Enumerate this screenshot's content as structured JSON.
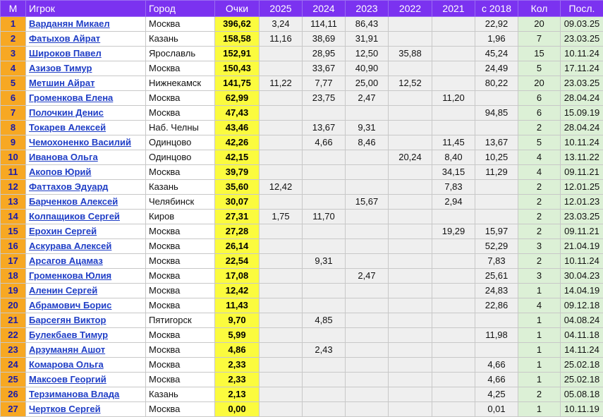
{
  "headers": [
    "М",
    "Игрок",
    "Город",
    "Очки",
    "2025",
    "2024",
    "2023",
    "2022",
    "2021",
    "с 2018",
    "Кол",
    "Посл."
  ],
  "rows": [
    {
      "rank": "1",
      "name": "Варданян Микаел",
      "city": "Москва",
      "points": "396,62",
      "y2025": "3,24",
      "y2024": "114,11",
      "y2023": "86,43",
      "y2022": "",
      "y2021": "",
      "since2018": "22,92",
      "count": "20",
      "last": "09.03.25"
    },
    {
      "rank": "2",
      "name": "Фатыхов Айрат",
      "city": "Казань",
      "points": "158,58",
      "y2025": "11,16",
      "y2024": "38,69",
      "y2023": "31,91",
      "y2022": "",
      "y2021": "",
      "since2018": "1,96",
      "count": "7",
      "last": "23.03.25"
    },
    {
      "rank": "3",
      "name": "Широков Павел",
      "city": "Ярославль",
      "points": "152,91",
      "y2025": "",
      "y2024": "28,95",
      "y2023": "12,50",
      "y2022": "35,88",
      "y2021": "",
      "since2018": "45,24",
      "count": "15",
      "last": "10.11.24"
    },
    {
      "rank": "4",
      "name": "Азизов Тимур",
      "city": "Москва",
      "points": "150,43",
      "y2025": "",
      "y2024": "33,67",
      "y2023": "40,90",
      "y2022": "",
      "y2021": "",
      "since2018": "24,49",
      "count": "5",
      "last": "17.11.24"
    },
    {
      "rank": "5",
      "name": "Метшин Айрат",
      "city": "Нижнекамск",
      "points": "141,75",
      "y2025": "11,22",
      "y2024": "7,77",
      "y2023": "25,00",
      "y2022": "12,52",
      "y2021": "",
      "since2018": "80,22",
      "count": "20",
      "last": "23.03.25"
    },
    {
      "rank": "6",
      "name": "Громенкова Елена",
      "city": "Москва",
      "points": "62,99",
      "y2025": "",
      "y2024": "23,75",
      "y2023": "2,47",
      "y2022": "",
      "y2021": "11,20",
      "since2018": "",
      "count": "6",
      "last": "28.04.24"
    },
    {
      "rank": "7",
      "name": "Полочкин Денис",
      "city": "Москва",
      "points": "47,43",
      "y2025": "",
      "y2024": "",
      "y2023": "",
      "y2022": "",
      "y2021": "",
      "since2018": "94,85",
      "count": "6",
      "last": "15.09.19"
    },
    {
      "rank": "8",
      "name": "Токарев Алексей",
      "city": "Наб. Челны",
      "points": "43,46",
      "y2025": "",
      "y2024": "13,67",
      "y2023": "9,31",
      "y2022": "",
      "y2021": "",
      "since2018": "",
      "count": "2",
      "last": "28.04.24"
    },
    {
      "rank": "9",
      "name": "Чемохоненко Василий",
      "city": "Одинцово",
      "points": "42,26",
      "y2025": "",
      "y2024": "4,66",
      "y2023": "8,46",
      "y2022": "",
      "y2021": "11,45",
      "since2018": "13,67",
      "count": "5",
      "last": "10.11.24"
    },
    {
      "rank": "10",
      "name": "Иванова Ольга",
      "city": "Одинцово",
      "points": "42,15",
      "y2025": "",
      "y2024": "",
      "y2023": "",
      "y2022": "20,24",
      "y2021": "8,40",
      "since2018": "10,25",
      "count": "4",
      "last": "13.11.22"
    },
    {
      "rank": "11",
      "name": "Акопов Юрий",
      "city": "Москва",
      "points": "39,79",
      "y2025": "",
      "y2024": "",
      "y2023": "",
      "y2022": "",
      "y2021": "34,15",
      "since2018": "11,29",
      "count": "4",
      "last": "09.11.21"
    },
    {
      "rank": "12",
      "name": "Фаттахов Эдуард",
      "city": "Казань",
      "points": "35,60",
      "y2025": "12,42",
      "y2024": "",
      "y2023": "",
      "y2022": "",
      "y2021": "7,83",
      "since2018": "",
      "count": "2",
      "last": "12.01.25"
    },
    {
      "rank": "13",
      "name": "Барченков Алексей",
      "city": "Челябинск",
      "points": "30,07",
      "y2025": "",
      "y2024": "",
      "y2023": "15,67",
      "y2022": "",
      "y2021": "2,94",
      "since2018": "",
      "count": "2",
      "last": "12.01.23"
    },
    {
      "rank": "14",
      "name": "Колпащиков Сергей",
      "city": "Киров",
      "points": "27,31",
      "y2025": "1,75",
      "y2024": "11,70",
      "y2023": "",
      "y2022": "",
      "y2021": "",
      "since2018": "",
      "count": "2",
      "last": "23.03.25"
    },
    {
      "rank": "15",
      "name": "Ерохин Сергей",
      "city": "Москва",
      "points": "27,28",
      "y2025": "",
      "y2024": "",
      "y2023": "",
      "y2022": "",
      "y2021": "19,29",
      "since2018": "15,97",
      "count": "2",
      "last": "09.11.21"
    },
    {
      "rank": "16",
      "name": "Аскурава Алексей",
      "city": "Москва",
      "points": "26,14",
      "y2025": "",
      "y2024": "",
      "y2023": "",
      "y2022": "",
      "y2021": "",
      "since2018": "52,29",
      "count": "3",
      "last": "21.04.19"
    },
    {
      "rank": "17",
      "name": "Арсагов Ацамаз",
      "city": "Москва",
      "points": "22,54",
      "y2025": "",
      "y2024": "9,31",
      "y2023": "",
      "y2022": "",
      "y2021": "",
      "since2018": "7,83",
      "count": "2",
      "last": "10.11.24"
    },
    {
      "rank": "18",
      "name": "Громенкова Юлия",
      "city": "Москва",
      "points": "17,08",
      "y2025": "",
      "y2024": "",
      "y2023": "2,47",
      "y2022": "",
      "y2021": "",
      "since2018": "25,61",
      "count": "3",
      "last": "30.04.23"
    },
    {
      "rank": "19",
      "name": "Аленин Сергей",
      "city": "Москва",
      "points": "12,42",
      "y2025": "",
      "y2024": "",
      "y2023": "",
      "y2022": "",
      "y2021": "",
      "since2018": "24,83",
      "count": "1",
      "last": "14.04.19"
    },
    {
      "rank": "20",
      "name": "Абрамович Борис",
      "city": "Москва",
      "points": "11,43",
      "y2025": "",
      "y2024": "",
      "y2023": "",
      "y2022": "",
      "y2021": "",
      "since2018": "22,86",
      "count": "4",
      "last": "09.12.18"
    },
    {
      "rank": "21",
      "name": "Барсегян Виктор",
      "city": "Пятигорск",
      "points": "9,70",
      "y2025": "",
      "y2024": "4,85",
      "y2023": "",
      "y2022": "",
      "y2021": "",
      "since2018": "",
      "count": "1",
      "last": "04.08.24"
    },
    {
      "rank": "22",
      "name": "Булекбаев Тимур",
      "city": "Москва",
      "points": "5,99",
      "y2025": "",
      "y2024": "",
      "y2023": "",
      "y2022": "",
      "y2021": "",
      "since2018": "11,98",
      "count": "1",
      "last": "04.11.18"
    },
    {
      "rank": "23",
      "name": "Арзуманян Ашот",
      "city": "Москва",
      "points": "4,86",
      "y2025": "",
      "y2024": "2,43",
      "y2023": "",
      "y2022": "",
      "y2021": "",
      "since2018": "",
      "count": "1",
      "last": "14.11.24"
    },
    {
      "rank": "24",
      "name": "Комарова Ольга",
      "city": "Москва",
      "points": "2,33",
      "y2025": "",
      "y2024": "",
      "y2023": "",
      "y2022": "",
      "y2021": "",
      "since2018": "4,66",
      "count": "1",
      "last": "25.02.18"
    },
    {
      "rank": "25",
      "name": "Максоев Георгий",
      "city": "Москва",
      "points": "2,33",
      "y2025": "",
      "y2024": "",
      "y2023": "",
      "y2022": "",
      "y2021": "",
      "since2018": "4,66",
      "count": "1",
      "last": "25.02.18"
    },
    {
      "rank": "26",
      "name": "Терзиманова Влада",
      "city": "Казань",
      "points": "2,13",
      "y2025": "",
      "y2024": "",
      "y2023": "",
      "y2022": "",
      "y2021": "",
      "since2018": "4,25",
      "count": "2",
      "last": "05.08.18"
    },
    {
      "rank": "27",
      "name": "Чертков Сергей",
      "city": "Москва",
      "points": "0,00",
      "y2025": "",
      "y2024": "",
      "y2023": "",
      "y2022": "",
      "y2021": "",
      "since2018": "0,01",
      "count": "1",
      "last": "10.11.19"
    }
  ],
  "colors": {
    "header_bg": "#7b32f0",
    "rank_bg": "#f7a823",
    "points_bg": "#fbfb3e",
    "years_bg": "#efefef",
    "count_bg": "#dcf0d6",
    "link": "#1f3ec6"
  }
}
